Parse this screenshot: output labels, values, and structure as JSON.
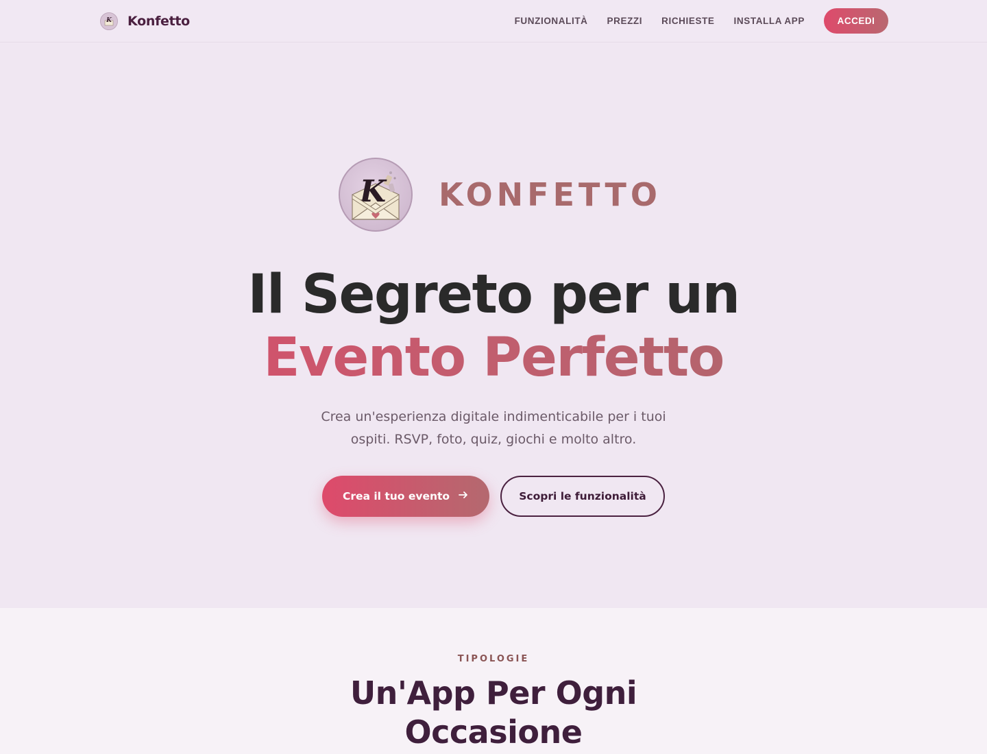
{
  "nav": {
    "brand": "Konfetto",
    "brand_icon": "konfetto-logo-icon",
    "links": [
      "FUNZIONALITÀ",
      "PREZZI",
      "RICHIESTE",
      "INSTALLA APP"
    ],
    "login_label": "ACCEDI"
  },
  "hero": {
    "logo_icon": "envelope-k-logo",
    "wordmark": "KONFETTO",
    "title_line1": "Il Segreto per un",
    "title_line2": "Evento Perfetto",
    "subtitle": "Crea un'esperienza digitale indimenticabile per i tuoi ospiti. RSVP, foto, quiz, giochi e molto altro.",
    "primary_cta": "Crea il tuo evento",
    "secondary_cta": "Scopri le funzionalità"
  },
  "section": {
    "eyebrow": "TIPOLOGIE",
    "title": "Un'App Per Ogni Occasione"
  },
  "colors": {
    "accent": "#de4a6b",
    "accent_end": "#a86a6c",
    "dark_plum": "#3f1f3c",
    "background": "#f0e7f2"
  }
}
